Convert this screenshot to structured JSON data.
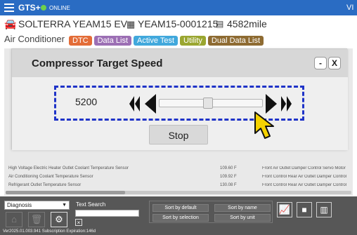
{
  "topbar": {
    "app_name": "GTS+",
    "status": "ONLINE",
    "corner": "VI"
  },
  "vehicle": {
    "model": "SOLTERRA YEAM15 EV",
    "id": "YEAM15-0001215",
    "mileage": "4582mile"
  },
  "breadcrumb": {
    "section": "Air Conditioner",
    "tabs": [
      {
        "label": "DTC"
      },
      {
        "label": "Data List"
      },
      {
        "label": "Active Test"
      },
      {
        "label": "Utility"
      },
      {
        "label": "Dual Data List"
      }
    ]
  },
  "modal": {
    "title": "Compressor Target Speed",
    "minimize": "-",
    "close": "X",
    "value": "5200",
    "stop_label": "Stop"
  },
  "table": {
    "rows": [
      {
        "name": "High Voltage Electric Heater Outlet Coolant Temperature Sensor",
        "value": "109.60 F",
        "other": "Front Air Outlet Damper Control Servo Motor"
      },
      {
        "name": "Air Conditioning Coolant Temperature Sensor",
        "value": "109.92 F",
        "other": "Front Control Rear Air Outlet Damper Control"
      },
      {
        "name": "Refrigerant Outlet Temperature Sensor",
        "value": "130.08 F",
        "other": "Front Control Rear Air Outlet Damper Control"
      }
    ]
  },
  "footer": {
    "dropdown_value": "Diagnosis",
    "text_search_label": "Text Search",
    "sort_default": "Sort by default",
    "sort_name": "Sort by name",
    "sort_selection": "Sort by selection",
    "sort_unit": "Sort by unit",
    "version": "Ver2025.01.003.941 Subscription Expiration:146d"
  }
}
